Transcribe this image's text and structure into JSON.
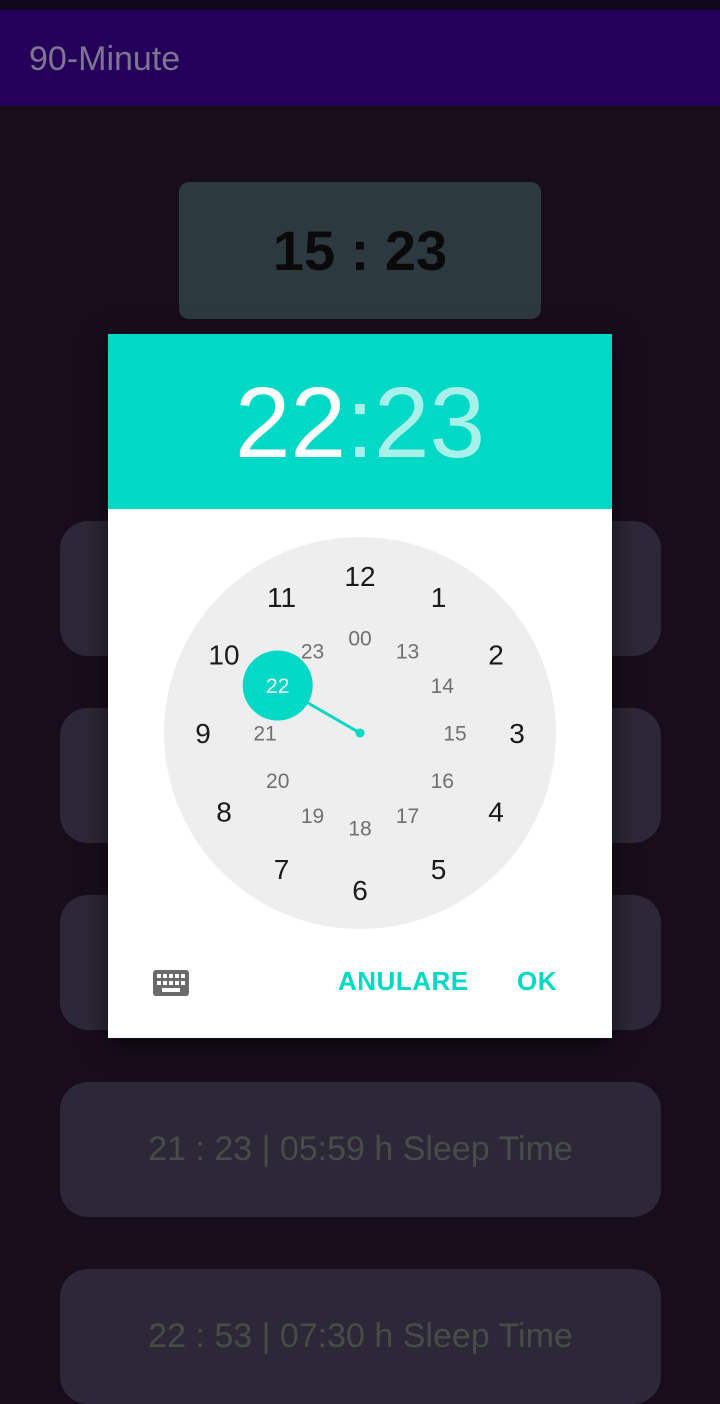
{
  "app": {
    "title": "90-Minute"
  },
  "current_time": "15 : 23",
  "cards": [
    {
      "text": ""
    },
    {
      "text": ""
    },
    {
      "text": ""
    },
    {
      "text": "21 : 23 | 05:59 h Sleep Time"
    },
    {
      "text": "22 : 53 | 07:30 h Sleep Time"
    }
  ],
  "dialog": {
    "hour": "22",
    "separator": ":",
    "minute": "23",
    "outer_hours": [
      "12",
      "1",
      "2",
      "3",
      "4",
      "5",
      "6",
      "7",
      "8",
      "9",
      "10",
      "11"
    ],
    "inner_hours": [
      "00",
      "13",
      "14",
      "15",
      "16",
      "17",
      "18",
      "19",
      "20",
      "21",
      "22",
      "23"
    ],
    "selected_hour": "22",
    "cancel_label": "ANULARE",
    "ok_label": "OK",
    "accent_color": "#00d9c6",
    "keyboard_icon": "keyboard-icon"
  }
}
